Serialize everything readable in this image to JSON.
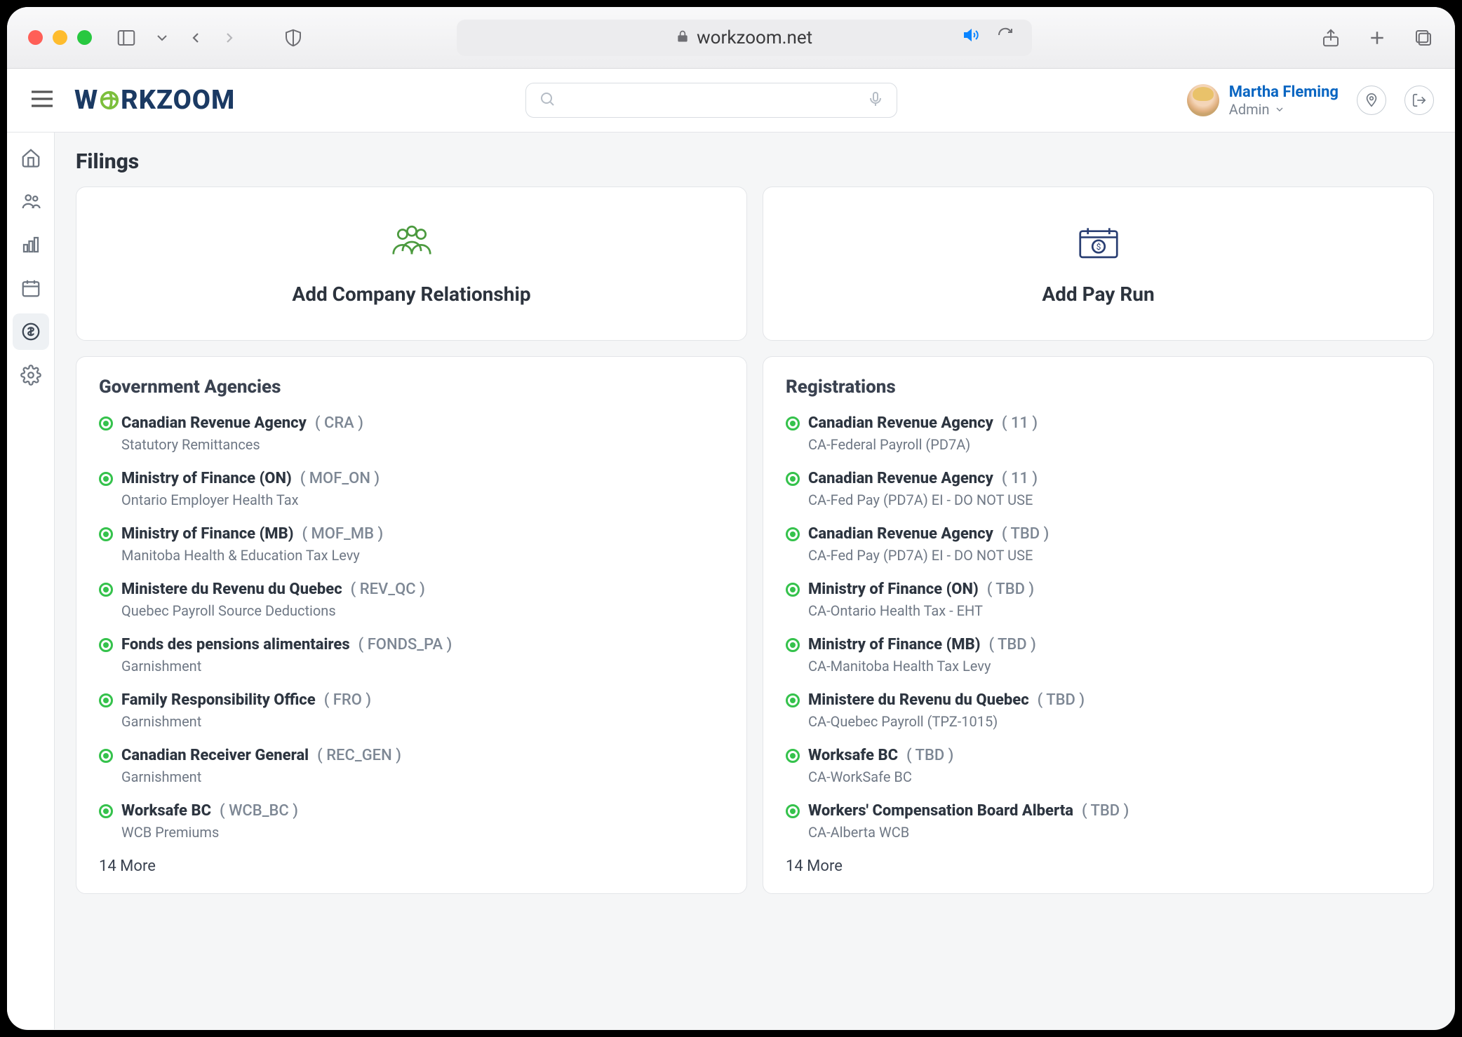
{
  "browser": {
    "url": "workzoom.net"
  },
  "header": {
    "logo": "WORKZOOM",
    "user": {
      "name": "Martha Fleming",
      "role": "Admin"
    }
  },
  "page": {
    "title": "Filings"
  },
  "actions": {
    "company": "Add Company Relationship",
    "payrun": "Add Pay Run"
  },
  "agencies": {
    "title": "Government Agencies",
    "items": [
      {
        "name": "Canadian Revenue Agency",
        "code": "( CRA )",
        "sub": "Statutory Remittances"
      },
      {
        "name": "Ministry of Finance (ON)",
        "code": "( MOF_ON )",
        "sub": "Ontario Employer Health Tax"
      },
      {
        "name": "Ministry of Finance (MB)",
        "code": "( MOF_MB )",
        "sub": "Manitoba Health & Education Tax Levy"
      },
      {
        "name": "Ministere du Revenu du Quebec",
        "code": "( REV_QC )",
        "sub": "Quebec Payroll Source Deductions"
      },
      {
        "name": "Fonds des pensions alimentaires",
        "code": "( FONDS_PA )",
        "sub": "Garnishment"
      },
      {
        "name": "Family Responsibility Office",
        "code": "( FRO )",
        "sub": "Garnishment"
      },
      {
        "name": "Canadian Receiver General",
        "code": "( REC_GEN )",
        "sub": "Garnishment"
      },
      {
        "name": "Worksafe BC",
        "code": "( WCB_BC )",
        "sub": "WCB Premiums"
      }
    ],
    "more": "14 More"
  },
  "registrations": {
    "title": "Registrations",
    "items": [
      {
        "name": "Canadian Revenue Agency",
        "code": "( 11 )",
        "sub": "CA-Federal Payroll (PD7A)"
      },
      {
        "name": "Canadian Revenue Agency",
        "code": "( 11 )",
        "sub": "CA-Fed Pay (PD7A) EI - DO NOT USE"
      },
      {
        "name": "Canadian Revenue Agency",
        "code": "( TBD )",
        "sub": "CA-Fed Pay (PD7A) EI - DO NOT USE"
      },
      {
        "name": "Ministry of Finance (ON)",
        "code": "( TBD )",
        "sub": "CA-Ontario Health Tax - EHT"
      },
      {
        "name": "Ministry of Finance (MB)",
        "code": "( TBD )",
        "sub": "CA-Manitoba Health Tax Levy"
      },
      {
        "name": "Ministere du Revenu du Quebec",
        "code": "( TBD )",
        "sub": "CA-Quebec Payroll (TPZ-1015)"
      },
      {
        "name": "Worksafe BC",
        "code": "( TBD )",
        "sub": "CA-WorkSafe BC"
      },
      {
        "name": "Workers' Compensation Board Alberta",
        "code": "( TBD )",
        "sub": "CA-Alberta WCB"
      }
    ],
    "more": "14 More"
  }
}
